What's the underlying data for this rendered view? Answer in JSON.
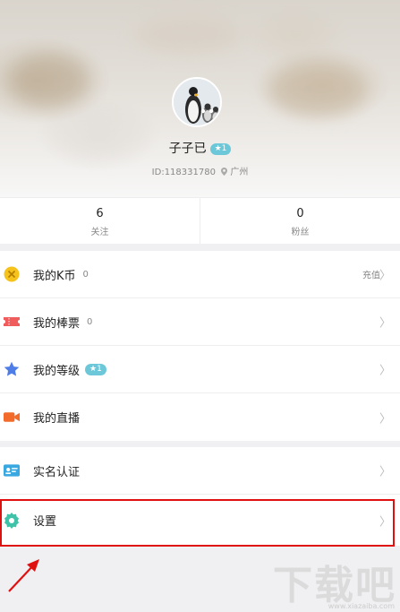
{
  "profile": {
    "username": "子子已",
    "level_badge": "★1",
    "id_text": "ID:118331780",
    "location": "广州"
  },
  "stats": [
    {
      "value": "6",
      "label": "关注"
    },
    {
      "value": "0",
      "label": "粉丝"
    }
  ],
  "menu_group1": [
    {
      "label": "我的K币",
      "count": "0",
      "right_text": "充值",
      "icon": "k-coin-icon",
      "color": "#f6c21c"
    },
    {
      "label": "我的棒票",
      "count": "0",
      "icon": "ticket-icon",
      "color": "#f05b5b"
    },
    {
      "label": "我的等级",
      "badge": "★1",
      "icon": "star-icon",
      "color": "#4f7de8"
    },
    {
      "label": "我的直播",
      "icon": "video-camera-icon",
      "color": "#f26b2a"
    }
  ],
  "menu_group2": [
    {
      "label": "实名认证",
      "icon": "id-card-icon",
      "color": "#39a8e0"
    },
    {
      "label": "设置",
      "icon": "settings-gear-icon",
      "color": "#3ec2a8"
    }
  ],
  "watermark": {
    "text": "下载吧",
    "sub": "www.xiazaiba.com"
  },
  "colors": {
    "highlight": "#e01010",
    "badge": "#6cc8d8",
    "arrow": "#e01010"
  }
}
